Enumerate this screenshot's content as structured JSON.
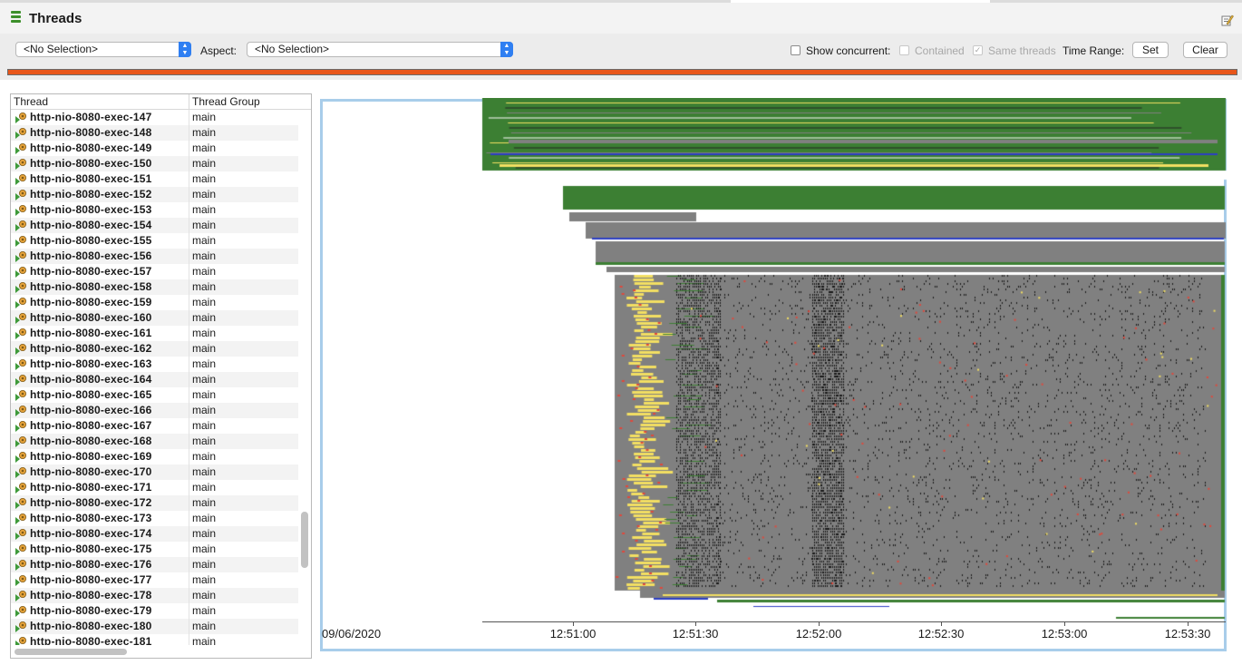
{
  "window": {
    "title": "Threads"
  },
  "toolbar": {
    "thread_select": "<No Selection>",
    "aspect_label": "Aspect:",
    "aspect_select": "<No Selection>",
    "show_concurrent_label": "Show concurrent:",
    "show_concurrent_checked": false,
    "contained_label": "Contained",
    "contained_checked": false,
    "same_threads_label": "Same threads",
    "same_threads_checked": true,
    "time_range_label": "Time Range:",
    "set_label": "Set",
    "clear_label": "Clear"
  },
  "table": {
    "col_thread": "Thread",
    "col_group": "Thread Group",
    "rows": [
      {
        "thread": "http-nio-8080-exec-147",
        "group": "main"
      },
      {
        "thread": "http-nio-8080-exec-148",
        "group": "main"
      },
      {
        "thread": "http-nio-8080-exec-149",
        "group": "main"
      },
      {
        "thread": "http-nio-8080-exec-150",
        "group": "main"
      },
      {
        "thread": "http-nio-8080-exec-151",
        "group": "main"
      },
      {
        "thread": "http-nio-8080-exec-152",
        "group": "main"
      },
      {
        "thread": "http-nio-8080-exec-153",
        "group": "main"
      },
      {
        "thread": "http-nio-8080-exec-154",
        "group": "main"
      },
      {
        "thread": "http-nio-8080-exec-155",
        "group": "main"
      },
      {
        "thread": "http-nio-8080-exec-156",
        "group": "main"
      },
      {
        "thread": "http-nio-8080-exec-157",
        "group": "main"
      },
      {
        "thread": "http-nio-8080-exec-158",
        "group": "main"
      },
      {
        "thread": "http-nio-8080-exec-159",
        "group": "main"
      },
      {
        "thread": "http-nio-8080-exec-160",
        "group": "main"
      },
      {
        "thread": "http-nio-8080-exec-161",
        "group": "main"
      },
      {
        "thread": "http-nio-8080-exec-162",
        "group": "main"
      },
      {
        "thread": "http-nio-8080-exec-163",
        "group": "main"
      },
      {
        "thread": "http-nio-8080-exec-164",
        "group": "main"
      },
      {
        "thread": "http-nio-8080-exec-165",
        "group": "main"
      },
      {
        "thread": "http-nio-8080-exec-166",
        "group": "main"
      },
      {
        "thread": "http-nio-8080-exec-167",
        "group": "main"
      },
      {
        "thread": "http-nio-8080-exec-168",
        "group": "main"
      },
      {
        "thread": "http-nio-8080-exec-169",
        "group": "main"
      },
      {
        "thread": "http-nio-8080-exec-170",
        "group": "main"
      },
      {
        "thread": "http-nio-8080-exec-171",
        "group": "main"
      },
      {
        "thread": "http-nio-8080-exec-172",
        "group": "main"
      },
      {
        "thread": "http-nio-8080-exec-173",
        "group": "main"
      },
      {
        "thread": "http-nio-8080-exec-174",
        "group": "main"
      },
      {
        "thread": "http-nio-8080-exec-175",
        "group": "main"
      },
      {
        "thread": "http-nio-8080-exec-176",
        "group": "main"
      },
      {
        "thread": "http-nio-8080-exec-177",
        "group": "main"
      },
      {
        "thread": "http-nio-8080-exec-178",
        "group": "main"
      },
      {
        "thread": "http-nio-8080-exec-179",
        "group": "main"
      },
      {
        "thread": "http-nio-8080-exec-180",
        "group": "main"
      },
      {
        "thread": "http-nio-8080-exec-181",
        "group": "main"
      }
    ]
  },
  "timeline": {
    "date_label": "09/06/2020",
    "ticks": [
      "12:51:00",
      "12:51:30",
      "12:52:00",
      "12:52:30",
      "12:53:00",
      "12:53:30"
    ],
    "colors": {
      "running": "#3c7f33",
      "waiting": "#808080",
      "blocked": "#e2473a",
      "sleeping": "#f3df62",
      "io": "#2c3ec3",
      "frame": "#a8cdea",
      "progress": "#e8561a"
    }
  }
}
